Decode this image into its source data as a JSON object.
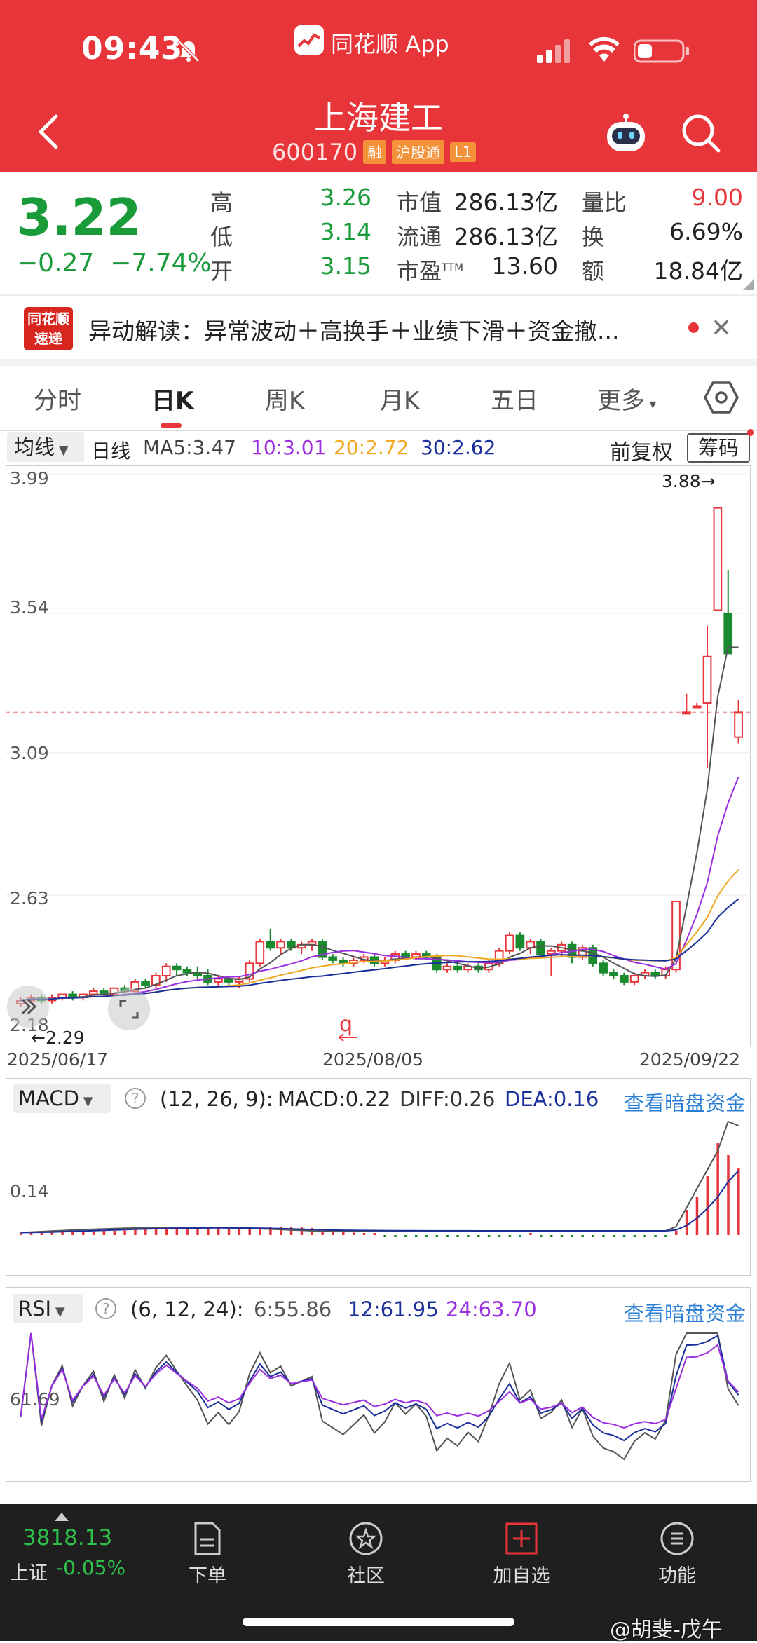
{
  "status": {
    "time": "09:43",
    "app_name": "同花顺 App"
  },
  "header": {
    "name": "上海建工",
    "code": "600170",
    "tags": [
      "融",
      "沪股通",
      "L1"
    ]
  },
  "quote": {
    "price": "3.22",
    "change": "−0.27",
    "pct": "−7.74%",
    "high_l": "高",
    "high": "3.26",
    "low_l": "低",
    "low": "3.14",
    "open_l": "开",
    "open": "3.15",
    "mcap_l": "市值",
    "mcap": "286.13亿",
    "float_l": "流通",
    "float": "286.13亿",
    "pe_l": "市盈",
    "pe_sup": "TTM",
    "pe": "13.60",
    "vr_l": "量比",
    "vr": "9.00",
    "turn_l": "换",
    "turn": "6.69%",
    "amt_l": "额",
    "amt": "18.84亿"
  },
  "interp": {
    "logo_line1": "同花顺",
    "logo_line2": "速递",
    "text": "异动解读：异常波动＋高换手＋业绩下滑＋资金撤..."
  },
  "tabs": [
    "分时",
    "日K",
    "周K",
    "月K",
    "五日",
    "更多"
  ],
  "active_tab": "日K",
  "ma": {
    "selector": "均线",
    "day": "日线",
    "ma5": "MA5:3.47",
    "ma10": "10:3.01",
    "ma20": "20:2.72",
    "ma30": "30:2.62",
    "adjust": "前复权",
    "chips": "筹码"
  },
  "colors": {
    "up": "#e8353a",
    "down": "#1a8a2e",
    "ma5": "#555555",
    "ma10": "#9b2fe0",
    "ma20": "#f0a820",
    "ma30": "#1a2f9a"
  },
  "chart_data": {
    "type": "candlestick",
    "ylim": [
      2.18,
      3.99
    ],
    "yticks": [
      "3.99",
      "3.54",
      "3.09",
      "2.63",
      "2.18"
    ],
    "xticks": [
      "2025/06/17",
      "2025/08/05",
      "2025/09/22"
    ],
    "max_label": "3.88→",
    "min_label": "←2.29",
    "current_price": 3.22,
    "marker": "q",
    "candles": [
      [
        2.28,
        2.3,
        2.27,
        2.29
      ],
      [
        2.29,
        2.31,
        2.28,
        2.3
      ],
      [
        2.3,
        2.31,
        2.28,
        2.29
      ],
      [
        2.29,
        2.31,
        2.28,
        2.3
      ],
      [
        2.3,
        2.31,
        2.29,
        2.31
      ],
      [
        2.31,
        2.32,
        2.29,
        2.3
      ],
      [
        2.3,
        2.31,
        2.29,
        2.31
      ],
      [
        2.31,
        2.33,
        2.3,
        2.32
      ],
      [
        2.32,
        2.33,
        2.3,
        2.31
      ],
      [
        2.31,
        2.33,
        2.3,
        2.33
      ],
      [
        2.33,
        2.34,
        2.31,
        2.32
      ],
      [
        2.32,
        2.36,
        2.31,
        2.35
      ],
      [
        2.35,
        2.36,
        2.33,
        2.34
      ],
      [
        2.34,
        2.38,
        2.33,
        2.37
      ],
      [
        2.37,
        2.41,
        2.35,
        2.4
      ],
      [
        2.4,
        2.41,
        2.37,
        2.39
      ],
      [
        2.39,
        2.4,
        2.37,
        2.38
      ],
      [
        2.38,
        2.4,
        2.36,
        2.37
      ],
      [
        2.37,
        2.39,
        2.34,
        2.35
      ],
      [
        2.35,
        2.37,
        2.33,
        2.36
      ],
      [
        2.36,
        2.37,
        2.34,
        2.35
      ],
      [
        2.35,
        2.37,
        2.33,
        2.36
      ],
      [
        2.36,
        2.42,
        2.35,
        2.41
      ],
      [
        2.41,
        2.49,
        2.4,
        2.48
      ],
      [
        2.48,
        2.52,
        2.45,
        2.46
      ],
      [
        2.46,
        2.49,
        2.44,
        2.48
      ],
      [
        2.48,
        2.49,
        2.45,
        2.46
      ],
      [
        2.46,
        2.48,
        2.44,
        2.47
      ],
      [
        2.47,
        2.49,
        2.45,
        2.48
      ],
      [
        2.48,
        2.49,
        2.42,
        2.43
      ],
      [
        2.43,
        2.44,
        2.41,
        2.42
      ],
      [
        2.42,
        2.43,
        2.4,
        2.41
      ],
      [
        2.41,
        2.43,
        2.4,
        2.42
      ],
      [
        2.42,
        2.44,
        2.41,
        2.43
      ],
      [
        2.43,
        2.44,
        2.4,
        2.41
      ],
      [
        2.41,
        2.43,
        2.4,
        2.42
      ],
      [
        2.42,
        2.45,
        2.41,
        2.44
      ],
      [
        2.44,
        2.45,
        2.42,
        2.43
      ],
      [
        2.43,
        2.45,
        2.42,
        2.44
      ],
      [
        2.44,
        2.45,
        2.42,
        2.43
      ],
      [
        2.43,
        2.44,
        2.38,
        2.39
      ],
      [
        2.39,
        2.41,
        2.38,
        2.4
      ],
      [
        2.4,
        2.41,
        2.38,
        2.39
      ],
      [
        2.39,
        2.41,
        2.38,
        2.4
      ],
      [
        2.4,
        2.41,
        2.38,
        2.39
      ],
      [
        2.39,
        2.42,
        2.38,
        2.41
      ],
      [
        2.41,
        2.46,
        2.4,
        2.45
      ],
      [
        2.45,
        2.51,
        2.44,
        2.5
      ],
      [
        2.5,
        2.51,
        2.45,
        2.46
      ],
      [
        2.46,
        2.49,
        2.44,
        2.48
      ],
      [
        2.48,
        2.49,
        2.43,
        2.44
      ],
      [
        2.44,
        2.46,
        2.37,
        2.45
      ],
      [
        2.45,
        2.48,
        2.43,
        2.47
      ],
      [
        2.47,
        2.48,
        2.41,
        2.43
      ],
      [
        2.43,
        2.47,
        2.42,
        2.46
      ],
      [
        2.46,
        2.47,
        2.4,
        2.41
      ],
      [
        2.41,
        2.42,
        2.37,
        2.38
      ],
      [
        2.38,
        2.39,
        2.36,
        2.37
      ],
      [
        2.37,
        2.38,
        2.34,
        2.35
      ],
      [
        2.35,
        2.38,
        2.34,
        2.37
      ],
      [
        2.37,
        2.39,
        2.36,
        2.38
      ],
      [
        2.38,
        2.39,
        2.36,
        2.37
      ],
      [
        2.37,
        2.4,
        2.36,
        2.39
      ],
      [
        2.39,
        2.61,
        2.38,
        2.61
      ],
      [
        3.22,
        3.28,
        3.22,
        3.22
      ],
      [
        3.24,
        3.25,
        3.24,
        3.24
      ],
      [
        3.25,
        3.5,
        3.04,
        3.4
      ],
      [
        3.55,
        3.88,
        3.55,
        3.88
      ],
      [
        3.54,
        3.68,
        3.41,
        3.41
      ],
      [
        3.14,
        3.26,
        3.12,
        3.22
      ]
    ],
    "ma_hint": "MA5 / MA10 / MA20 / MA30"
  },
  "macd": {
    "selector": "MACD",
    "params": "(12, 26, 9):",
    "macd": "MACD:0.22",
    "diff": "DIFF:0.26",
    "dea": "DEA:0.16",
    "link": "查看暗盘资金",
    "ytick": "0.14",
    "bars": [
      0.005,
      0.006,
      0.006,
      0.007,
      0.007,
      0.008,
      0.008,
      0.009,
      0.01,
      0.01,
      0.011,
      0.012,
      0.013,
      0.014,
      0.016,
      0.018,
      0.019,
      0.018,
      0.017,
      0.016,
      0.015,
      0.015,
      0.016,
      0.018,
      0.02,
      0.02,
      0.019,
      0.018,
      0.017,
      0.015,
      0.012,
      0.009,
      0.006,
      0.003,
      0.001,
      -0.001,
      -0.002,
      -0.003,
      -0.003,
      -0.004,
      -0.004,
      -0.004,
      -0.004,
      -0.004,
      -0.004,
      -0.004,
      -0.003,
      -0.002,
      -0.001,
      0.0,
      -0.001,
      -0.002,
      -0.002,
      -0.003,
      -0.003,
      -0.004,
      -0.004,
      -0.005,
      -0.005,
      -0.005,
      -0.005,
      -0.004,
      -0.004,
      0.01,
      0.06,
      0.09,
      0.14,
      0.22,
      0.19,
      0.16
    ]
  },
  "rsi": {
    "selector": "RSI",
    "params": "(6, 12, 24):",
    "r6": "6:55.86",
    "r12": "12:61.95",
    "r24": "24:63.70",
    "link": "查看暗盘资金",
    "ytick": "61.69"
  },
  "bottom": {
    "index_val": "3818.13",
    "index_name": "上证",
    "index_pct": "-0.05%",
    "nav": [
      "下单",
      "社区",
      "加自选",
      "功能"
    ],
    "watermark": "@胡斐-戊午"
  }
}
